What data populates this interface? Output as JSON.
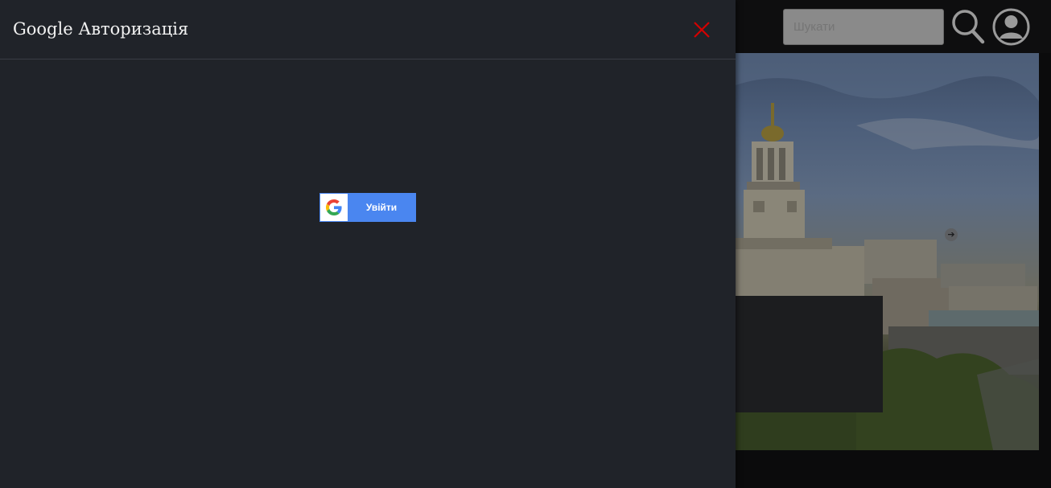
{
  "header": {
    "search": {
      "placeholder": "Шукати"
    },
    "search_icon": "search-icon",
    "user_icon": "user-account-icon"
  },
  "hero": {
    "next_icon": "arrow-right-circle-icon",
    "next_glyph": "➔"
  },
  "modal": {
    "title": "Google Авторизація",
    "close_icon": "close-icon",
    "close_color": "#d40000",
    "google_button": {
      "icon": "google-icon",
      "label": "Увійти",
      "color": "#4a86f0"
    }
  }
}
